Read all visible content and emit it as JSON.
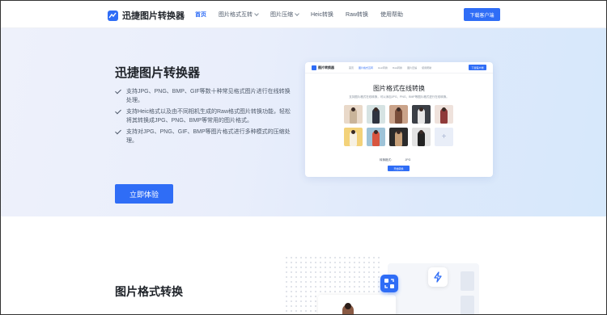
{
  "header": {
    "logo_text": "迅捷图片转换器",
    "nav": [
      {
        "label": "首页",
        "active": true,
        "dropdown": false
      },
      {
        "label": "图片格式互转",
        "active": false,
        "dropdown": true
      },
      {
        "label": "图片压缩",
        "active": false,
        "dropdown": true
      },
      {
        "label": "Heic转换",
        "active": false,
        "dropdown": false
      },
      {
        "label": "Raw转换",
        "active": false,
        "dropdown": false
      },
      {
        "label": "使用帮助",
        "active": false,
        "dropdown": false
      }
    ],
    "download_label": "下载客户端"
  },
  "hero": {
    "title": "迅捷图片转换器",
    "features": [
      "支持JPG、PNG、BMP、GIF等数十种常见格式图片进行在线转换处理。",
      "支持Heic格式以及由不同相机生成的Raw格式图片转换功能，轻松将其转换成JPG、PNG、BMP等常用的图片格式。",
      "支持对JPG、PNG、GIF、BMP等图片格式进行多种模式的压缩处理。"
    ],
    "try_label": "立即体验"
  },
  "mockup": {
    "logo_text": "图片转换器",
    "nav": [
      "首页",
      "图片格式互转",
      "Heic转换",
      "Raw转换",
      "图片压缩",
      "使用帮助"
    ],
    "download_label": "下载客户端",
    "title": "图片格式在线转换",
    "subtitle": "支持图片格式在线转换，可以添加JPG、PNG、BMP等图片格式进行在线转换。",
    "format_label": "转换格式：",
    "format_value": "JPG",
    "convert_label": "开始转换"
  },
  "section2": {
    "title": "图片格式转换"
  },
  "colors": {
    "accent": "#2f6df6",
    "text": "#1f2329",
    "muted": "#4e5969"
  }
}
